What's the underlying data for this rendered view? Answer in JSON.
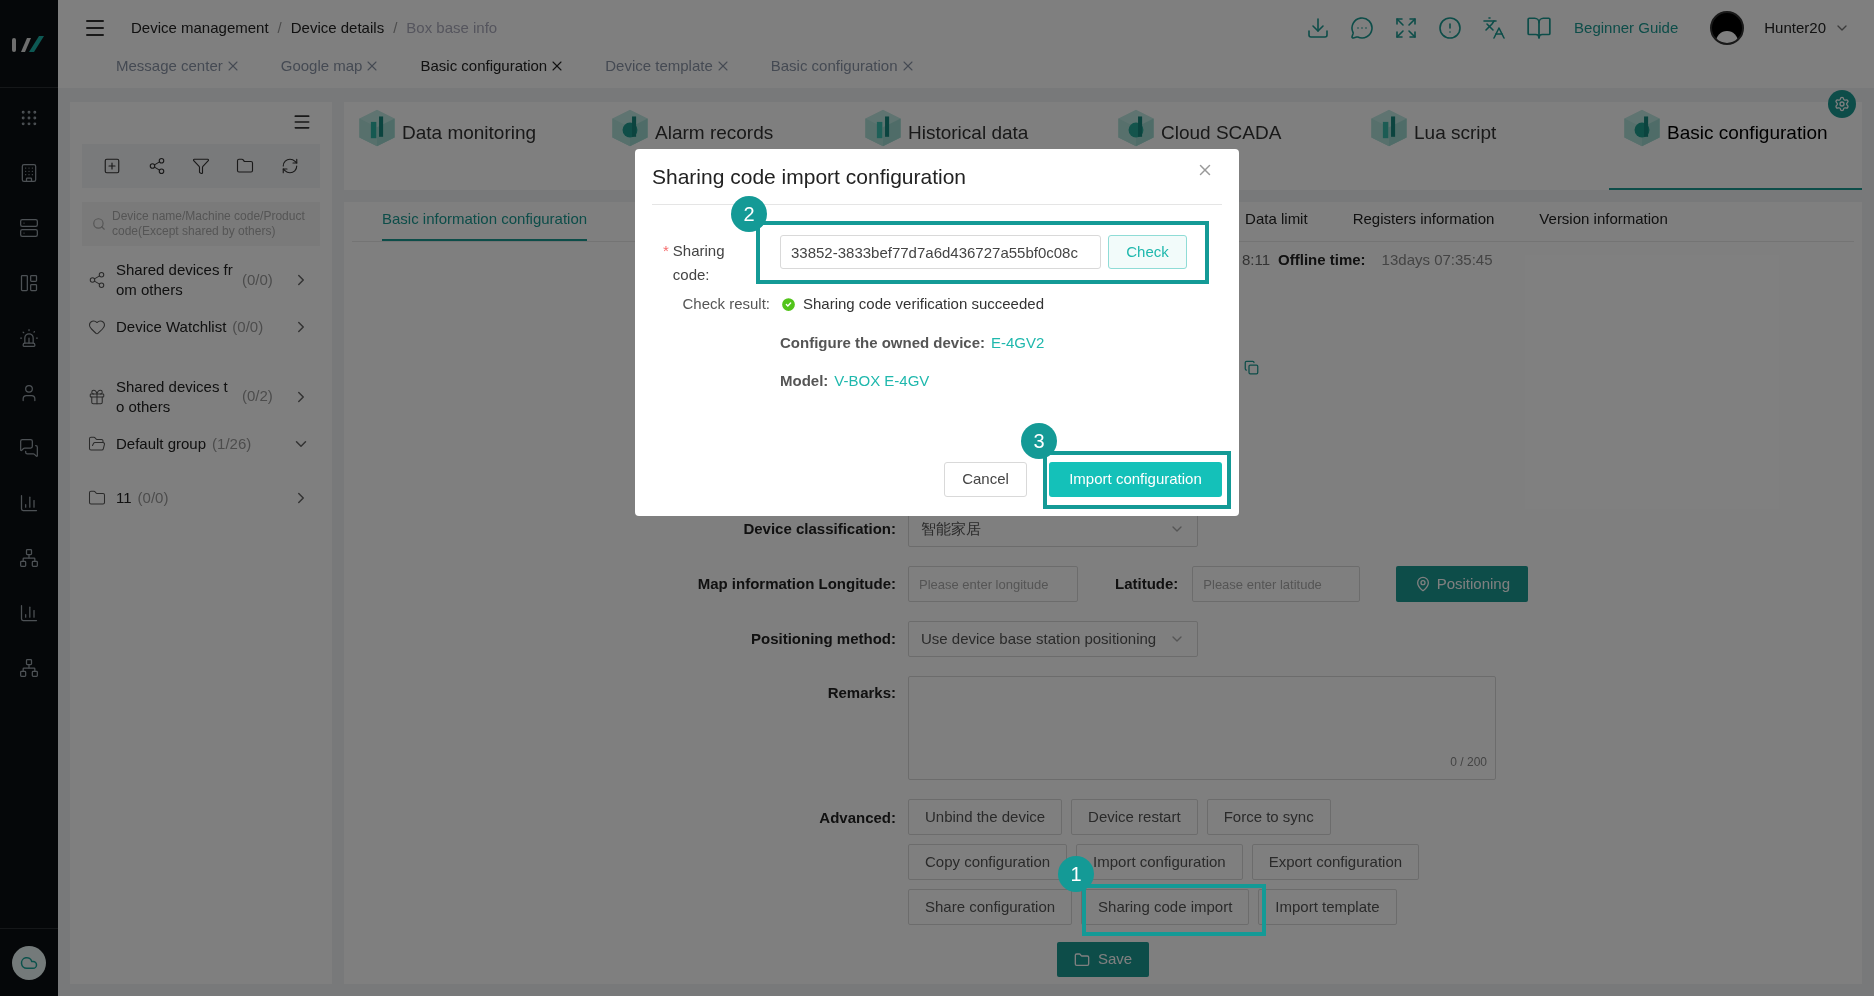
{
  "header": {
    "breadcrumb": [
      {
        "label": "Device management",
        "current": false
      },
      {
        "separator": "/",
        "label": "Device details",
        "current": false
      },
      {
        "separator": "/",
        "label": "Box base info",
        "current": true
      }
    ],
    "guide": "Beginner Guide",
    "user": "Hunter20"
  },
  "open_tabs": [
    {
      "label": "Message center",
      "selected": false
    },
    {
      "label": "Google map",
      "selected": false
    },
    {
      "label": "Basic configuration",
      "selected": true
    },
    {
      "label": "Device template",
      "selected": false
    },
    {
      "label": "Basic configuration",
      "selected": false
    }
  ],
  "sidebar": {
    "search_placeholder": "Device name/Machine code/Product code(Except shared by others)",
    "items": [
      {
        "kind": "share",
        "label": "Shared devices from others",
        "count": "(0/0)",
        "expanded": false
      },
      {
        "kind": "heart",
        "label": "Device Watchlist",
        "count": "(0/0)",
        "expanded": false
      },
      {
        "kind": "gift",
        "label": "Shared devices to others",
        "count": "(0/2)",
        "expanded": false
      },
      {
        "kind": "folder-open",
        "label": "Default group",
        "count": "(1/26)",
        "expanded": true
      },
      {
        "kind": "folder",
        "label": "11",
        "count": "(0/0)",
        "expanded": false
      }
    ]
  },
  "modules": [
    {
      "label": "Data monitoring",
      "selected": false
    },
    {
      "label": "Alarm records",
      "selected": false
    },
    {
      "label": "Historical data",
      "selected": false
    },
    {
      "label": "Cloud SCADA",
      "selected": false
    },
    {
      "label": "Lua script",
      "selected": false
    },
    {
      "label": "Basic configuration",
      "selected": true
    }
  ],
  "sub_tabs": [
    {
      "label": "Basic information configuration",
      "selected": true
    },
    {
      "label": "Data limit",
      "selected": false
    },
    {
      "label": "Registers information",
      "selected": false
    },
    {
      "label": "Version information",
      "selected": false
    }
  ],
  "status": {
    "fragment": "8:11",
    "offline_label": "Offline time:",
    "offline_value": "13days 07:35:45"
  },
  "form": {
    "classification": {
      "label": "Device classification:",
      "value": "智能家居"
    },
    "longitude": {
      "label": "Map information Longitude:",
      "placeholder": "Please enter longitude"
    },
    "latitude": {
      "label": "Latitude:",
      "placeholder": "Please enter latitude"
    },
    "positioning_button": "Positioning",
    "method": {
      "label": "Positioning method:",
      "value": "Use device base station positioning"
    },
    "remarks": {
      "label": "Remarks:",
      "counter": "0 / 200"
    },
    "advanced": {
      "label": "Advanced:",
      "rows": [
        {
          "buttons": [
            "Unbind the device",
            "Device restart",
            "Force to sync"
          ]
        },
        {
          "buttons": [
            "Copy configuration",
            "Import configuration",
            "Export configuration"
          ]
        },
        {
          "buttons": [
            "Share configuration",
            "Sharing code import",
            "Import template"
          ]
        }
      ]
    },
    "save": "Save"
  },
  "dialog": {
    "title": "Sharing code import configuration",
    "required_mark": "*",
    "code_label": "Sharing code:",
    "code_value": "33852-3833bef77d7a6d436727a55bf0c08c",
    "check": "Check",
    "result_label": "Check result:",
    "result": "Sharing code verification succeeded",
    "device_label": "Configure the owned device:",
    "device_value": "E-4GV2",
    "model_label": "Model:",
    "model_value": "V-BOX E-4GV",
    "cancel": "Cancel",
    "confirm": "Import configuration"
  },
  "callouts": [
    {
      "number": "1"
    },
    {
      "number": "2"
    },
    {
      "number": "3"
    }
  ]
}
